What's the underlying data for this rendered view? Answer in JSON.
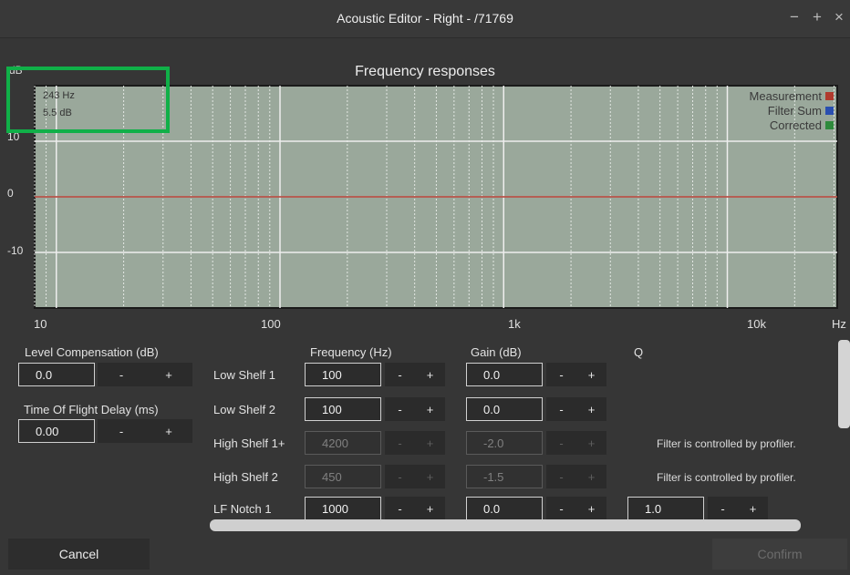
{
  "window": {
    "title": "Acoustic Editor - Right - /71769",
    "controls": {
      "minimize": "−",
      "maximize": "+",
      "close": "×"
    }
  },
  "chart_data": {
    "type": "line",
    "title": "Frequency responses",
    "ylabel": "dB",
    "xlabel": "Hz",
    "x_scale": "log",
    "xlim": [
      8,
      31000
    ],
    "ylim": [
      -20,
      20
    ],
    "x_ticks": [
      "10",
      "100",
      "1k",
      "10k"
    ],
    "x_tick_values": [
      10,
      100,
      1000,
      10000
    ],
    "y_ticks": [
      "10",
      "0",
      "-10"
    ],
    "y_tick_values": [
      10,
      0,
      -10
    ],
    "grid": true,
    "legend_placement": "top-right",
    "legend": [
      {
        "label": "Measurement",
        "color": "#b03a2e"
      },
      {
        "label": "Filter Sum",
        "color": "#2a4fb0"
      },
      {
        "label": "Corrected",
        "color": "#2e8a3c"
      }
    ],
    "series": [
      {
        "name": "Measurement",
        "color": "#b03a2e",
        "x": [
          8,
          31000
        ],
        "y": [
          0,
          0
        ]
      }
    ],
    "cursor_readout": {
      "freq": "243 Hz",
      "gain": "5.5 dB"
    }
  },
  "colors": {
    "plot_bg": "#9aa89b",
    "grid_major": "#eeeeee",
    "grid_minor": "#e2e7e2",
    "highlight": "#10b048"
  },
  "controls": {
    "level_comp_label": "Level Compensation (dB)",
    "level_comp_value": "0.0",
    "tof_label": "Time Of Flight Delay (ms)",
    "tof_value": "0.00",
    "minus": "-",
    "plus": "+"
  },
  "filters": {
    "header_freq": "Frequency (Hz)",
    "header_gain": "Gain (dB)",
    "header_q": "Q",
    "profiler_note": "Filter is controlled by profiler.",
    "rows": [
      {
        "name": "Low Shelf 1",
        "freq": "100",
        "gain": "0.0"
      },
      {
        "name": "Low Shelf 2",
        "freq": "100",
        "gain": "0.0"
      },
      {
        "name": "High Shelf 1+",
        "freq": "4200",
        "gain": "-2.0"
      },
      {
        "name": "High Shelf 2",
        "freq": "450",
        "gain": "-1.5"
      },
      {
        "name": "LF Notch 1",
        "freq": "1000",
        "gain": "0.0",
        "q": "1.0"
      }
    ]
  },
  "footer": {
    "cancel": "Cancel",
    "confirm": "Confirm"
  }
}
